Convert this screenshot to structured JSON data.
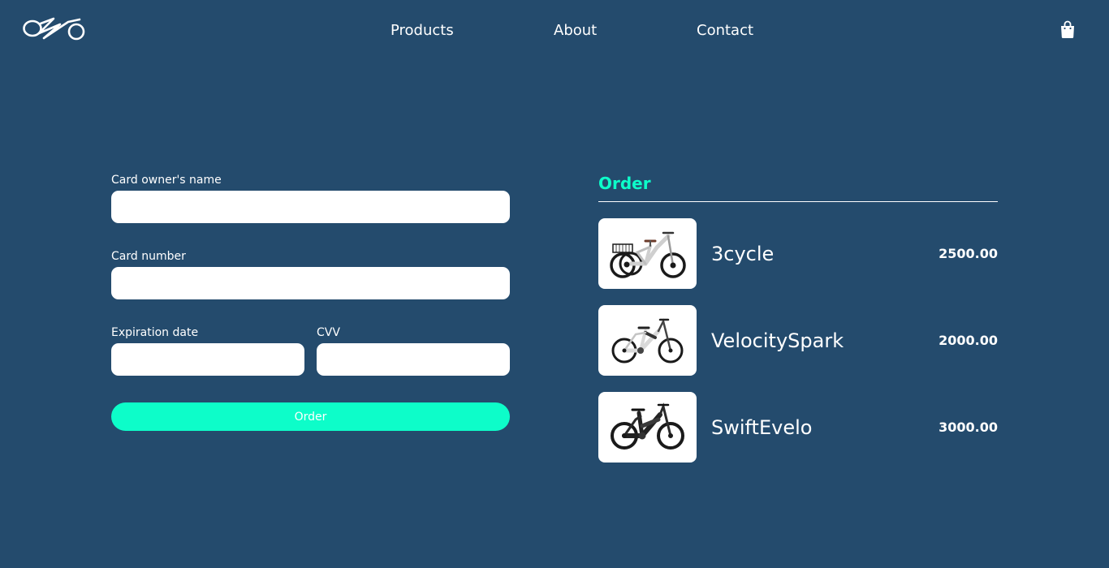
{
  "header": {
    "logo_icon": "bike-logo-icon",
    "nav": [
      {
        "label": "Products"
      },
      {
        "label": "About"
      },
      {
        "label": "Contact"
      }
    ],
    "cart_icon": "shopping-bag-icon"
  },
  "payment_form": {
    "card_owner_label": "Card owner's name",
    "card_owner_value": "",
    "card_number_label": "Card number",
    "card_number_value": "",
    "expiration_label": "Expiration date",
    "expiration_value": "",
    "cvv_label": "CVV",
    "cvv_value": "",
    "submit_label": "Order"
  },
  "order": {
    "title": "Order",
    "items": [
      {
        "name": "3cycle",
        "price": "2500.00",
        "image_icon": "tricycle-icon"
      },
      {
        "name": "VelocitySpark",
        "price": "2000.00",
        "image_icon": "white-ebike-icon"
      },
      {
        "name": "SwiftEvelo",
        "price": "3000.00",
        "image_icon": "black-ebike-icon"
      }
    ]
  },
  "colors": {
    "background": "#244b6d",
    "accent": "#0dfdc9",
    "text": "#ffffff"
  }
}
